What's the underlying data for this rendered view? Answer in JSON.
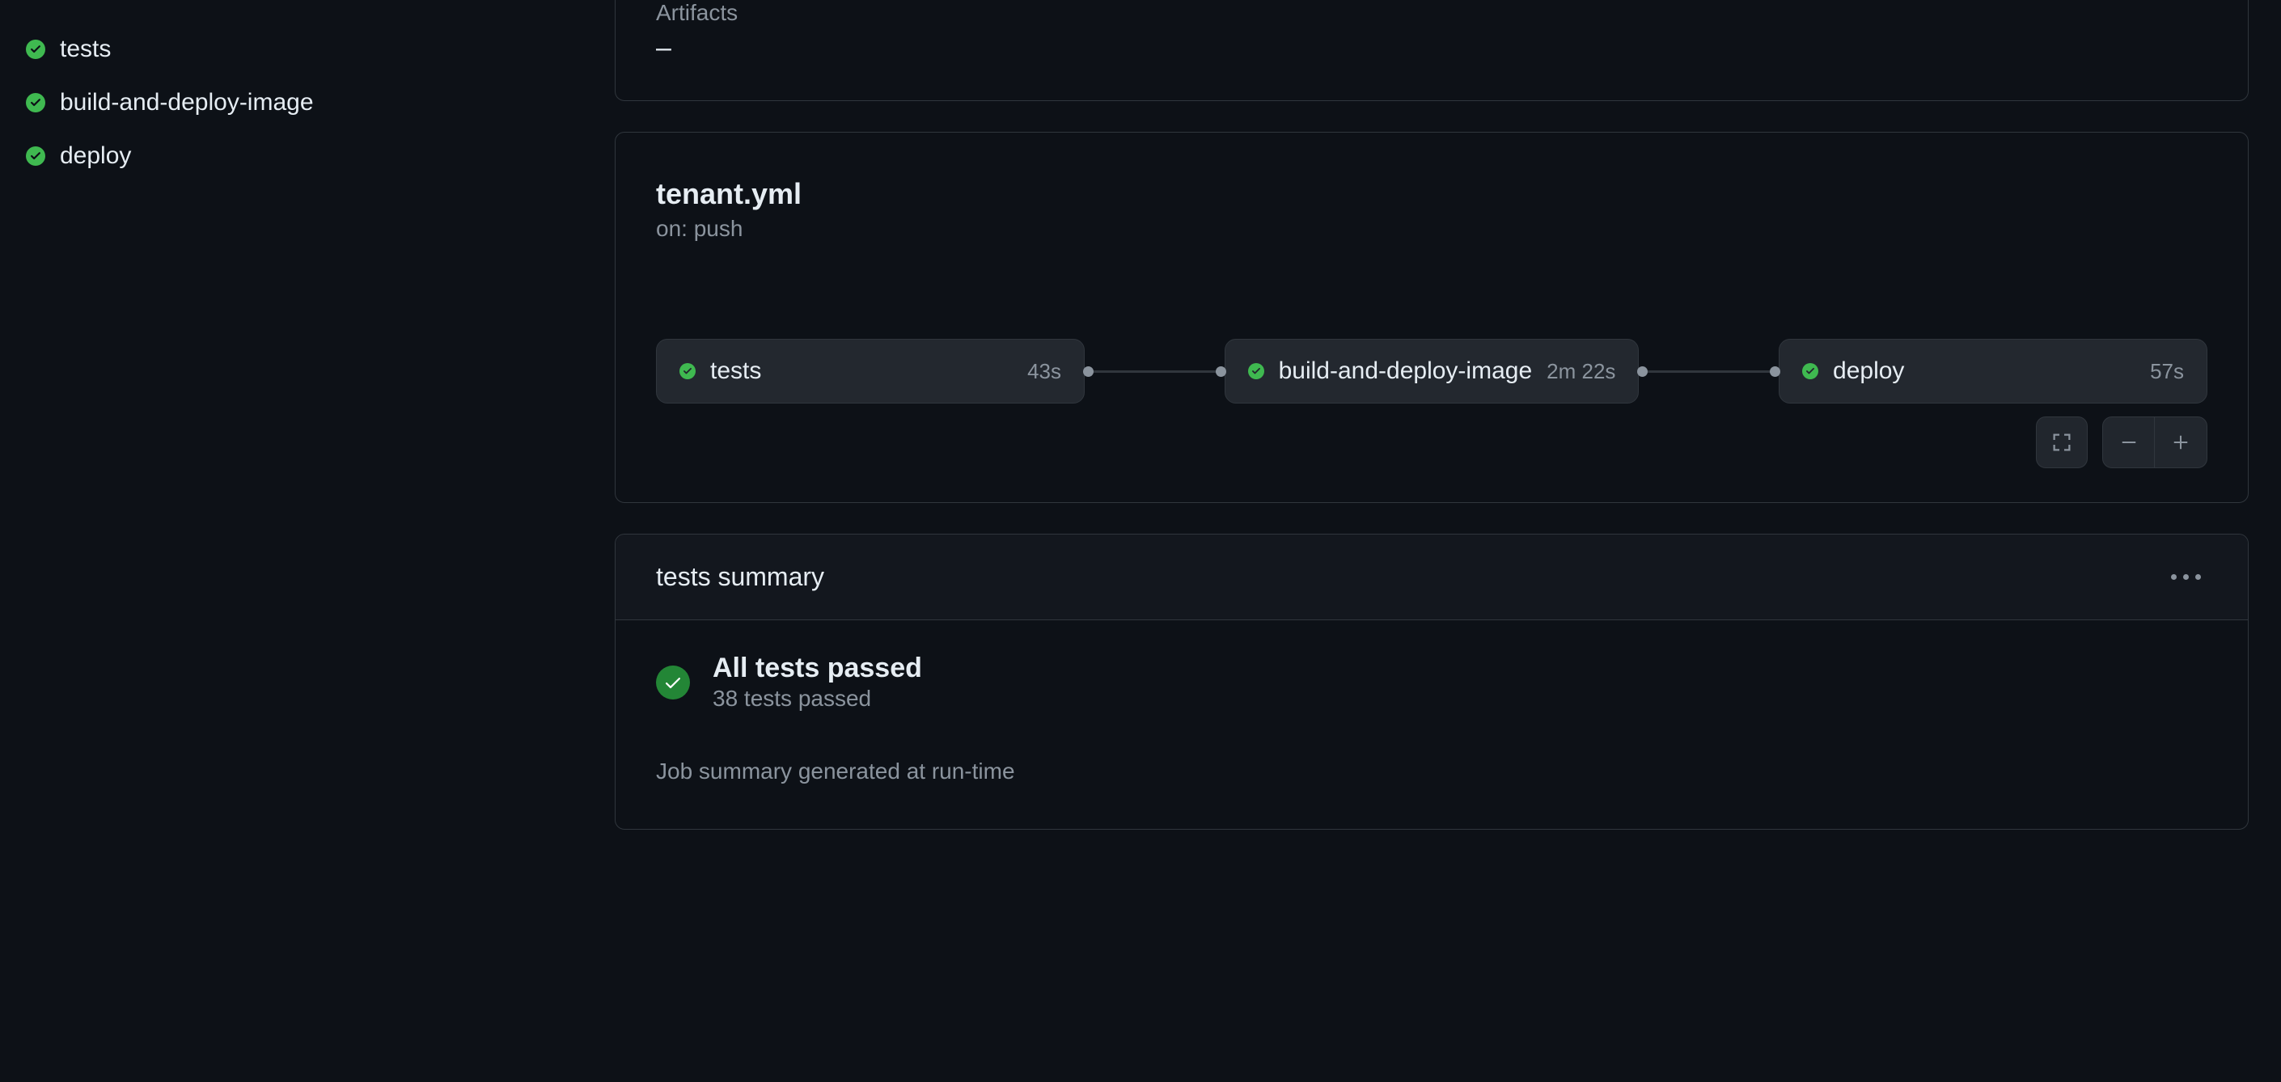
{
  "sidebar": {
    "items": [
      {
        "label": "tests"
      },
      {
        "label": "build-and-deploy-image"
      },
      {
        "label": "deploy"
      }
    ]
  },
  "artifacts": {
    "label": "Artifacts",
    "value": "–"
  },
  "workflow": {
    "title": "tenant.yml",
    "trigger": "on: push",
    "jobs": [
      {
        "name": "tests",
        "duration": "43s"
      },
      {
        "name": "build-and-deploy-image",
        "duration": "2m 22s"
      },
      {
        "name": "deploy",
        "duration": "57s"
      }
    ]
  },
  "summary": {
    "title": "tests summary",
    "headline": "All tests passed",
    "subtext": "38 tests passed",
    "footer": "Job summary generated at run-time"
  }
}
